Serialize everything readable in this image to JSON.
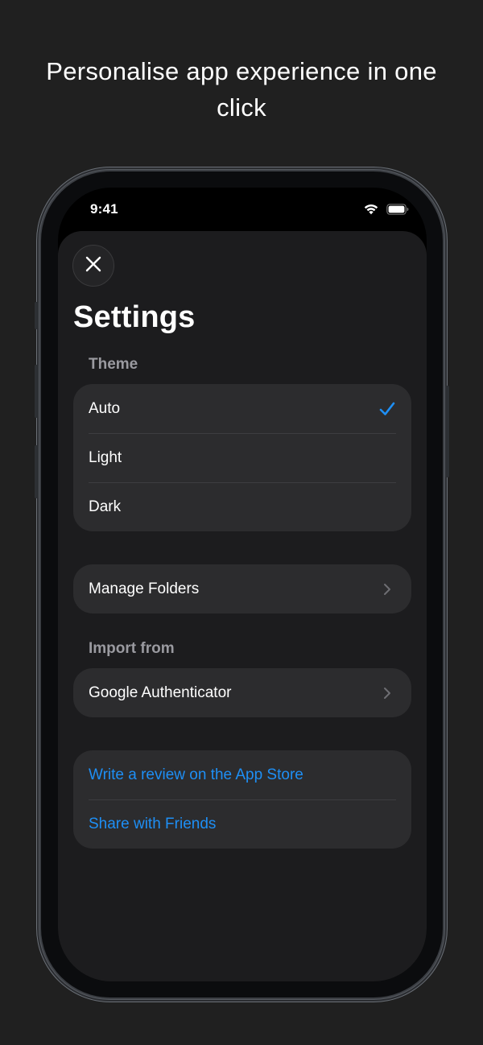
{
  "headline": "Personalise app experience in one click",
  "status_bar": {
    "time": "9:41",
    "icons": [
      "wifi-icon",
      "battery-icon"
    ]
  },
  "sheet": {
    "close_icon": "close-icon",
    "title": "Settings",
    "theme_section": {
      "label": "Theme",
      "options": [
        {
          "label": "Auto",
          "selected": true
        },
        {
          "label": "Light",
          "selected": false
        },
        {
          "label": "Dark",
          "selected": false
        }
      ]
    },
    "manage_folders": {
      "label": "Manage Folders",
      "icon": "chevron-right-icon"
    },
    "import_section": {
      "label": "Import from",
      "items": [
        {
          "label": "Google Authenticator",
          "icon": "chevron-right-icon"
        }
      ]
    },
    "links": [
      {
        "label": "Write a review on the App Store"
      },
      {
        "label": "Share with Friends"
      }
    ]
  },
  "colors": {
    "accent": "#1e8ff5",
    "background": "#202020",
    "sheet": "#1c1c1e",
    "group": "#2c2c2e",
    "secondary_text": "#9a9aa0"
  }
}
